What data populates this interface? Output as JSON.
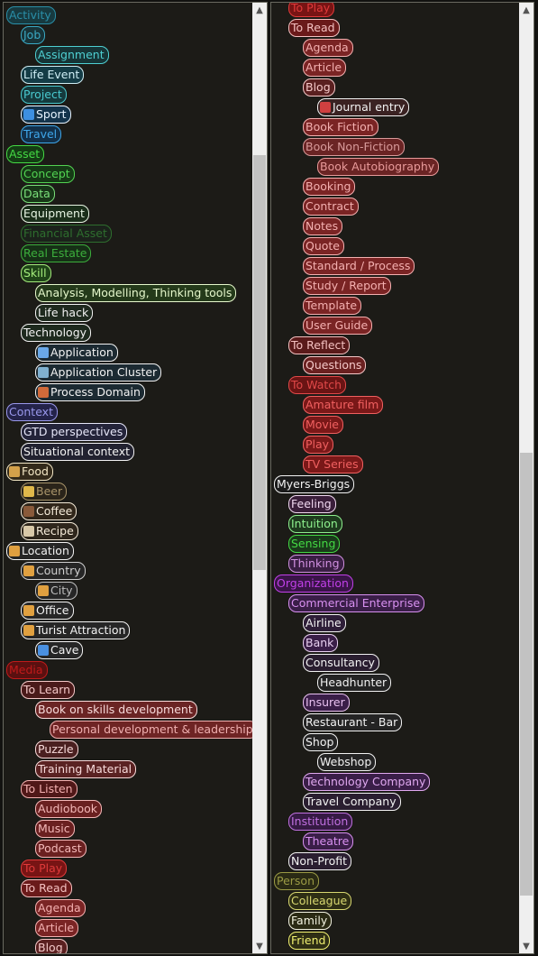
{
  "left_tree": [
    {
      "label": "Activity",
      "level": 0,
      "c": "#2a8fa8",
      "bg": "#173a40"
    },
    {
      "label": "Job",
      "level": 1,
      "c": "#3aa9c4",
      "bg": "#183338"
    },
    {
      "label": "Assignment",
      "level": 2,
      "c": "#4ecfd2",
      "bg": "#163436"
    },
    {
      "label": "Life Event",
      "level": 1,
      "c": "#cfeef5",
      "bg": "#143c46"
    },
    {
      "label": "Project",
      "level": 1,
      "c": "#49c9cf",
      "bg": "#153a3d"
    },
    {
      "label": "Sport",
      "level": 1,
      "c": "#e8f4ff",
      "bg": "#14344c",
      "icon": "sport-icon",
      "ic": "#3d8fe0"
    },
    {
      "label": "Travel",
      "level": 1,
      "c": "#3ea6ea",
      "bg": "#12304a"
    },
    {
      "label": "Asset",
      "level": 0,
      "c": "#44d944",
      "bg": "#143d14"
    },
    {
      "label": "Concept",
      "level": 1,
      "c": "#52d352",
      "bg": "#163a16"
    },
    {
      "label": "Data",
      "level": 1,
      "c": "#7ae07a",
      "bg": "#183618"
    },
    {
      "label": "Equipment",
      "level": 1,
      "c": "#e8f5e4",
      "bg": "#1a2e1a"
    },
    {
      "label": "Financial Asset",
      "level": 1,
      "c": "#2e6e2e",
      "bg": "#1b221b"
    },
    {
      "label": "Real Estate",
      "level": 1,
      "c": "#3cae3c",
      "bg": "#163016"
    },
    {
      "label": "Skill",
      "level": 1,
      "c": "#a4ec7c",
      "bg": "#1f4418"
    },
    {
      "label": "Analysis, Modelling, Thinking tools",
      "level": 2,
      "c": "#e6f8cc",
      "bg": "#243a1a"
    },
    {
      "label": "Life hack",
      "level": 2,
      "c": "#f2f2f2",
      "bg": "#1f2a1f"
    },
    {
      "label": "Technology",
      "level": 1,
      "c": "#f2f2f2",
      "bg": "#1e2a1e"
    },
    {
      "label": "Application",
      "level": 2,
      "c": "#f2f2f2",
      "bg": "#1c2a32",
      "icon": "application-icon",
      "ic": "#6aa8e8"
    },
    {
      "label": "Application Cluster",
      "level": 2,
      "c": "#f2f2f2",
      "bg": "#1c2a32",
      "icon": "application-cluster-icon",
      "ic": "#7fb0d0"
    },
    {
      "label": "Process Domain",
      "level": 2,
      "c": "#f2f2f2",
      "bg": "#1c2a32",
      "icon": "process-domain-icon",
      "ic": "#d06a3a"
    },
    {
      "label": "Context",
      "level": 0,
      "c": "#9a98ec",
      "bg": "#24234a"
    },
    {
      "label": "GTD perspectives",
      "level": 1,
      "c": "#e6e6f8",
      "bg": "#24243a"
    },
    {
      "label": "Situational context",
      "level": 1,
      "c": "#f2f2f2",
      "bg": "#222230"
    },
    {
      "label": "Food",
      "level": 0,
      "c": "#f2e6c4",
      "bg": "#332a1a",
      "icon": "food-icon",
      "ic": "#d4a14a"
    },
    {
      "label": "Beer",
      "level": 1,
      "c": "#a8946a",
      "bg": "#2a241a",
      "icon": "beer-icon",
      "ic": "#e0b84a"
    },
    {
      "label": "Coffee",
      "level": 1,
      "c": "#f4ead8",
      "bg": "#30261a",
      "icon": "coffee-icon",
      "ic": "#8a5a3a"
    },
    {
      "label": "Recipe",
      "level": 1,
      "c": "#f4ead8",
      "bg": "#2e261c",
      "icon": "recipe-icon",
      "ic": "#d8c8a8"
    },
    {
      "label": "Location",
      "level": 0,
      "c": "#f2f2f2",
      "bg": "#262626",
      "icon": "location-icon",
      "ic": "#e0a040"
    },
    {
      "label": "Country",
      "level": 1,
      "c": "#cfcfcf",
      "bg": "#262626",
      "icon": "country-icon",
      "ic": "#e0a040"
    },
    {
      "label": "City",
      "level": 2,
      "c": "#bdbdbd",
      "bg": "#262626",
      "icon": "city-icon",
      "ic": "#e0a040"
    },
    {
      "label": "Office",
      "level": 1,
      "c": "#f2f2f2",
      "bg": "#262626",
      "icon": "office-icon",
      "ic": "#e0a040"
    },
    {
      "label": "Turist Attraction",
      "level": 1,
      "c": "#f2f2f2",
      "bg": "#262626",
      "icon": "turist-attraction-icon",
      "ic": "#e0a040"
    },
    {
      "label": "Cave",
      "level": 2,
      "c": "#f2f2f2",
      "bg": "#262626",
      "icon": "cave-icon",
      "ic": "#4a90e0"
    },
    {
      "label": "Media",
      "level": 0,
      "c": "#c01a1a",
      "bg": "#5a1010"
    },
    {
      "label": "To Learn",
      "level": 1,
      "c": "#f4c8c8",
      "bg": "#4a1a1a"
    },
    {
      "label": "Book on skills development",
      "level": 2,
      "c": "#f8dada",
      "bg": "#6a2424"
    },
    {
      "label": "Personal development & leadership",
      "level": 3,
      "c": "#f0b0b0",
      "bg": "#6e2424"
    },
    {
      "label": "Puzzle",
      "level": 2,
      "c": "#f8dada",
      "bg": "#4a2020"
    },
    {
      "label": "Training Material",
      "level": 2,
      "c": "#f8dada",
      "bg": "#5a2222"
    },
    {
      "label": "To Listen",
      "level": 1,
      "c": "#f4b0b0",
      "bg": "#501818"
    },
    {
      "label": "Audiobook",
      "level": 2,
      "c": "#f4b8b8",
      "bg": "#6a2020"
    },
    {
      "label": "Music",
      "level": 2,
      "c": "#f4b8b8",
      "bg": "#6a2020"
    },
    {
      "label": "Podcast",
      "level": 2,
      "c": "#f4b8b8",
      "bg": "#6a2020"
    },
    {
      "label": "To Play",
      "level": 1,
      "c": "#e03a3a",
      "bg": "#781414"
    },
    {
      "label": "To Read",
      "level": 1,
      "c": "#f4c0c0",
      "bg": "#6a1a1a"
    },
    {
      "label": "Agenda",
      "level": 2,
      "c": "#f4b0b0",
      "bg": "#7a2424"
    },
    {
      "label": "Article",
      "level": 2,
      "c": "#f4b0b0",
      "bg": "#7a2424"
    },
    {
      "label": "Blog",
      "level": 2,
      "c": "#f4c8c8",
      "bg": "#5a2020"
    }
  ],
  "right_tree": [
    {
      "label": "To Play",
      "level": 1,
      "c": "#e03a3a",
      "bg": "#781414"
    },
    {
      "label": "To Read",
      "level": 1,
      "c": "#f4c0c0",
      "bg": "#6a1a1a"
    },
    {
      "label": "Agenda",
      "level": 2,
      "c": "#f4b0b0",
      "bg": "#7a2424"
    },
    {
      "label": "Article",
      "level": 2,
      "c": "#f4b0b0",
      "bg": "#7a2424"
    },
    {
      "label": "Blog",
      "level": 2,
      "c": "#f4c8c8",
      "bg": "#5a2020"
    },
    {
      "label": "Journal entry",
      "level": 3,
      "c": "#f2f2f2",
      "bg": "#3a2222",
      "icon": "journal-entry-icon",
      "ic": "#d04040"
    },
    {
      "label": "Book Fiction",
      "level": 2,
      "c": "#f4b0b0",
      "bg": "#7a2424"
    },
    {
      "label": "Book Non-Fiction",
      "level": 2,
      "c": "#d89a9a",
      "bg": "#6a2424"
    },
    {
      "label": "Book Autobiography",
      "level": 3,
      "c": "#e89a9a",
      "bg": "#6a2424"
    },
    {
      "label": "Booking",
      "level": 2,
      "c": "#f4b0b0",
      "bg": "#7a2424"
    },
    {
      "label": "Contract",
      "level": 2,
      "c": "#f4b0b0",
      "bg": "#7a2424"
    },
    {
      "label": "Notes",
      "level": 2,
      "c": "#f4b0b0",
      "bg": "#7a2424"
    },
    {
      "label": "Quote",
      "level": 2,
      "c": "#f4b0b0",
      "bg": "#7a2424"
    },
    {
      "label": "Standard / Process",
      "level": 2,
      "c": "#f4b0b0",
      "bg": "#7a2424"
    },
    {
      "label": "Study / Report",
      "level": 2,
      "c": "#f4b0b0",
      "bg": "#7a2424"
    },
    {
      "label": "Template",
      "level": 2,
      "c": "#f4b0b0",
      "bg": "#7a2424"
    },
    {
      "label": "User Guide",
      "level": 2,
      "c": "#f4b0b0",
      "bg": "#7a2424"
    },
    {
      "label": "To Reflect",
      "level": 1,
      "c": "#f4c0c0",
      "bg": "#5a1a1a"
    },
    {
      "label": "Questions",
      "level": 2,
      "c": "#f4c8c8",
      "bg": "#6a2020"
    },
    {
      "label": "To Watch",
      "level": 1,
      "c": "#e04848",
      "bg": "#6a1414"
    },
    {
      "label": "Amature film",
      "level": 2,
      "c": "#f06060",
      "bg": "#7a1818"
    },
    {
      "label": "Movie",
      "level": 2,
      "c": "#f06060",
      "bg": "#7a1818"
    },
    {
      "label": "Play",
      "level": 2,
      "c": "#f06060",
      "bg": "#7a1818"
    },
    {
      "label": "TV Series",
      "level": 2,
      "c": "#f06060",
      "bg": "#7a1818"
    },
    {
      "label": "Myers-Briggs",
      "level": 0,
      "c": "#f2f2f2",
      "bg": "#1a1a1a"
    },
    {
      "label": "Feeling",
      "level": 1,
      "c": "#f0d8f0",
      "bg": "#3a1e3a"
    },
    {
      "label": "Intuition",
      "level": 1,
      "c": "#8ef08e",
      "bg": "#1e3a1e"
    },
    {
      "label": "Sensing",
      "level": 1,
      "c": "#44d944",
      "bg": "#1a3a1a"
    },
    {
      "label": "Thinking",
      "level": 1,
      "c": "#d090e0",
      "bg": "#3a1e44"
    },
    {
      "label": "Organization",
      "level": 0,
      "c": "#c040e8",
      "bg": "#3a1448"
    },
    {
      "label": "Commercial Enterprise",
      "level": 1,
      "c": "#d890f0",
      "bg": "#3a1e48"
    },
    {
      "label": "Airline",
      "level": 2,
      "c": "#f2f2f2",
      "bg": "#2e1e38"
    },
    {
      "label": "Bank",
      "level": 2,
      "c": "#e8d0f0",
      "bg": "#3a1e48"
    },
    {
      "label": "Consultancy",
      "level": 2,
      "c": "#f2f2f2",
      "bg": "#2a1e30"
    },
    {
      "label": "Headhunter",
      "level": 3,
      "c": "#f2f2f2",
      "bg": "#242424"
    },
    {
      "label": "Insurer",
      "level": 2,
      "c": "#e8c0f0",
      "bg": "#3a1e48"
    },
    {
      "label": "Restaurant - Bar",
      "level": 2,
      "c": "#f2f2f2",
      "bg": "#242424"
    },
    {
      "label": "Shop",
      "level": 2,
      "c": "#f2f2f2",
      "bg": "#242424"
    },
    {
      "label": "Webshop",
      "level": 3,
      "c": "#f2f2f2",
      "bg": "#242424"
    },
    {
      "label": "Technology Company",
      "level": 2,
      "c": "#e0a8f0",
      "bg": "#3a1e48"
    },
    {
      "label": "Travel Company",
      "level": 2,
      "c": "#f2f2f2",
      "bg": "#2a1e30"
    },
    {
      "label": "Institution",
      "level": 1,
      "c": "#c070e0",
      "bg": "#361a44"
    },
    {
      "label": "Theatre",
      "level": 2,
      "c": "#d890f0",
      "bg": "#3a1e48"
    },
    {
      "label": "Non-Profit",
      "level": 1,
      "c": "#f2f2f2",
      "bg": "#2a1e30"
    },
    {
      "label": "Person",
      "level": 0,
      "c": "#9a9a44",
      "bg": "#2a2a14"
    },
    {
      "label": "Colleague",
      "level": 1,
      "c": "#d8d870",
      "bg": "#2e2e14"
    },
    {
      "label": "Family",
      "level": 1,
      "c": "#f2f2e0",
      "bg": "#2a2a14"
    },
    {
      "label": "Friend",
      "level": 1,
      "c": "#f0f070",
      "bg": "#2e2e14"
    }
  ],
  "left_scroll": {
    "position": 0.15,
    "visible": 0.45
  },
  "right_scroll": {
    "position": 0.5,
    "visible": 0.48
  }
}
